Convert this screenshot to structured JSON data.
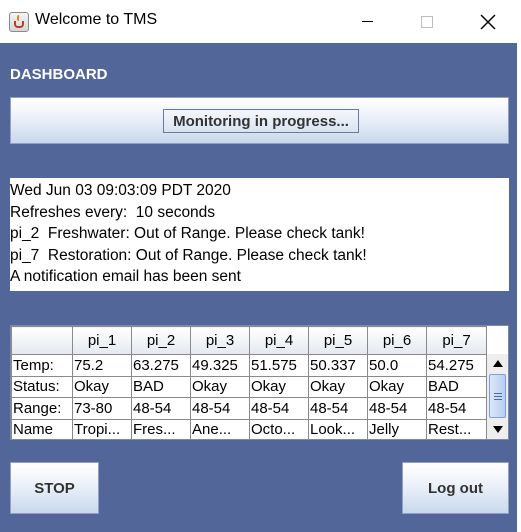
{
  "window": {
    "title": "Welcome to TMS",
    "app_icon": "java-cup-icon"
  },
  "dashboard": {
    "label": "DASHBOARD",
    "status_button": "Monitoring in progress..."
  },
  "notices": [
    "Wed Jun 03 09:03:09 PDT 2020",
    "Refreshes every:  10 seconds",
    "pi_2  Freshwater: Out of Range. Please check tank!",
    "pi_7  Restoration: Out of Range. Please check tank!",
    "A notification email has been sent"
  ],
  "table": {
    "columns": [
      "",
      "pi_1",
      "pi_2",
      "pi_3",
      "pi_4",
      "pi_5",
      "pi_6",
      "pi_7"
    ],
    "rows": [
      [
        "Temp:",
        "75.2",
        "63.275",
        "49.325",
        "51.575",
        "50.337",
        "50.0",
        "54.275"
      ],
      [
        "Status:",
        "Okay",
        "BAD",
        "Okay",
        "Okay",
        "Okay",
        "Okay",
        "BAD"
      ],
      [
        "Range:",
        "73-80",
        "48-54",
        "48-54",
        "48-54",
        "48-54",
        "48-54",
        "48-54"
      ],
      [
        "Name",
        "Tropi...",
        "Fres...",
        "Ane...",
        "Octo...",
        "Look...",
        "Jelly",
        "Rest..."
      ]
    ]
  },
  "buttons": {
    "stop": "STOP",
    "logout": "Log out"
  },
  "colors": {
    "frame_background": "#536699",
    "button_gradient_end": "#c9d8ec"
  }
}
